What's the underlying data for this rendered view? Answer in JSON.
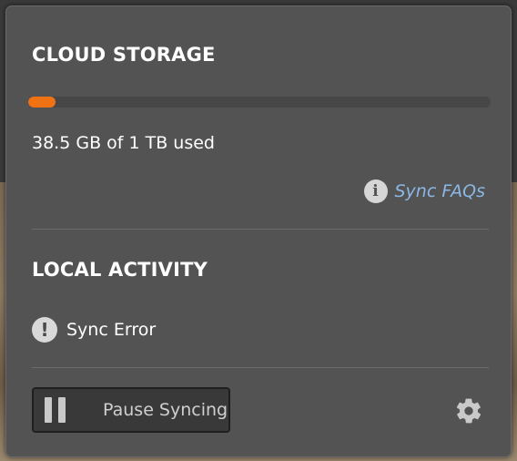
{
  "cloud_storage": {
    "title": "CLOUD STORAGE",
    "usage_text": "38.5 GB of 1 TB used",
    "used_fraction": 0.0385,
    "bar_fill_color": "#f07212",
    "faq_icon": "info-icon",
    "faq_link": "Sync FAQs"
  },
  "local_activity": {
    "title": "LOCAL ACTIVITY",
    "status_icon": "alert-icon",
    "status_text": "Sync Error"
  },
  "footer": {
    "pause_label": "Pause Syncing",
    "pause_icon": "pause-icon",
    "settings_icon": "gear-icon"
  },
  "colors": {
    "panel": "#535353",
    "link": "#8bb8e6",
    "text": "#ffffff"
  }
}
